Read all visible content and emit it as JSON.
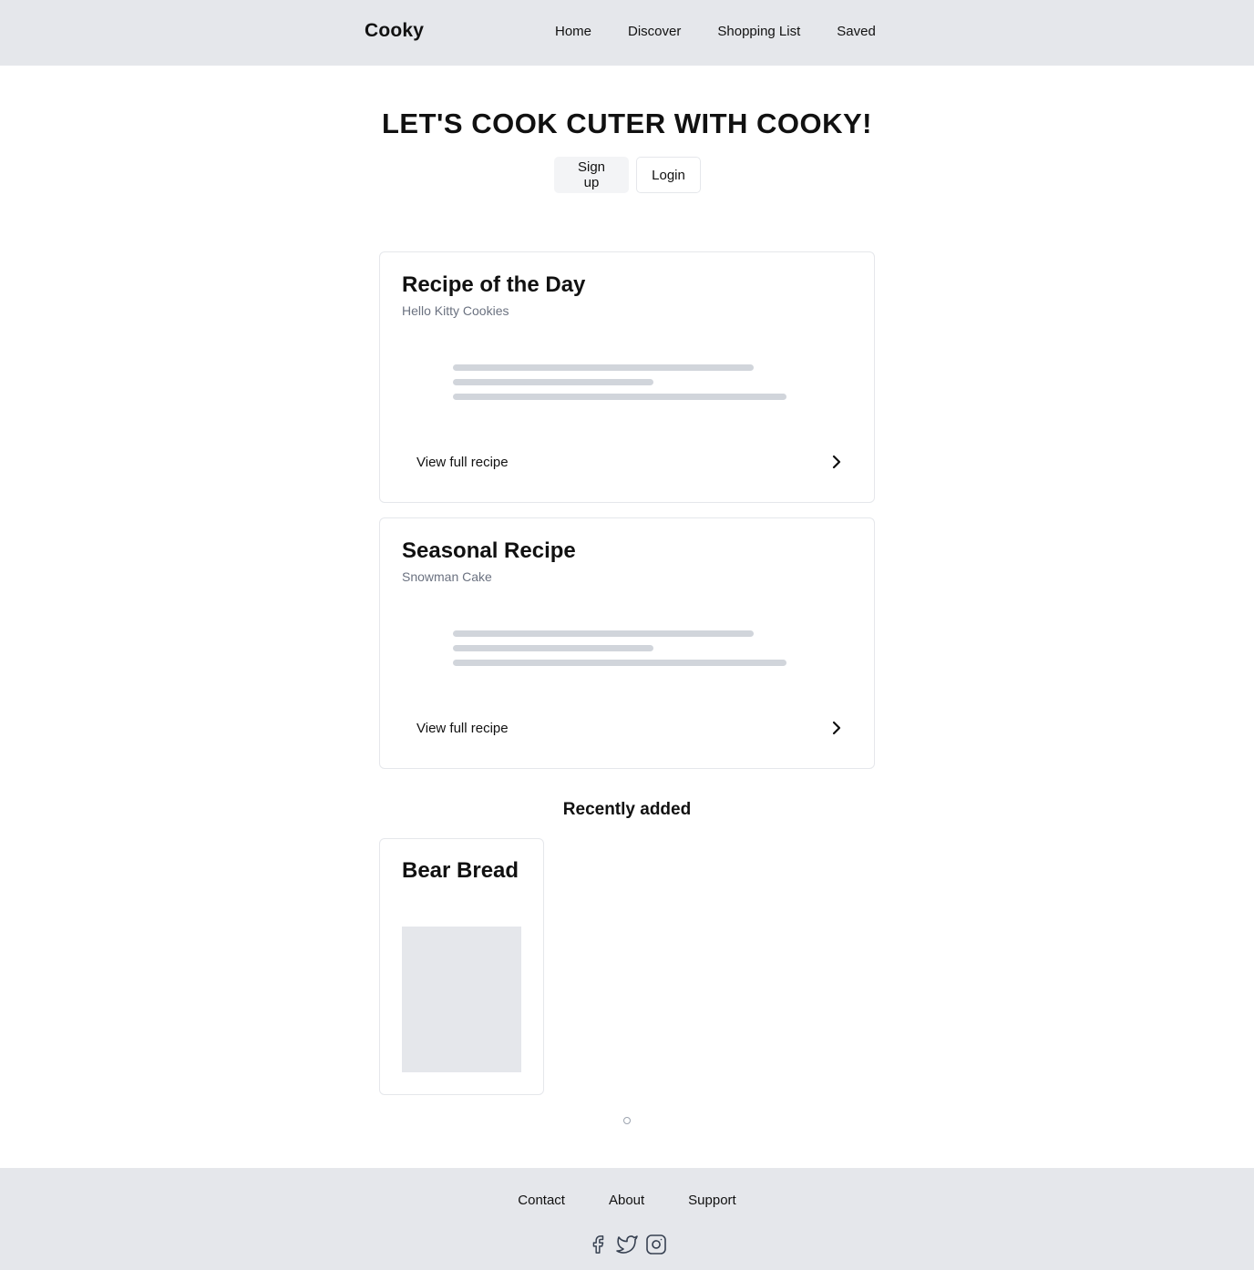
{
  "header": {
    "brand": "Cooky",
    "nav": [
      {
        "label": "Home"
      },
      {
        "label": "Discover"
      },
      {
        "label": "Shopping List"
      },
      {
        "label": "Saved"
      }
    ]
  },
  "hero": {
    "title": "LET'S COOK CUTER WITH COOKY!",
    "signup_label": "Sign up",
    "login_label": "Login"
  },
  "cards": [
    {
      "title": "Recipe of the Day",
      "subtitle": "Hello Kitty Cookies",
      "link_label": "View full recipe",
      "link_icon": "chevron-right-icon"
    },
    {
      "title": "Seasonal Recipe",
      "subtitle": "Snowman Cake",
      "link_label": "View full recipe",
      "link_icon": "chevron-right-icon"
    }
  ],
  "recently_added": {
    "title": "Recently added",
    "items": [
      {
        "title": "Bear Bread"
      }
    ],
    "pagination": {
      "current": 1,
      "total": 1
    }
  },
  "footer": {
    "links": [
      {
        "label": "Contact"
      },
      {
        "label": "About"
      },
      {
        "label": "Support"
      }
    ],
    "socials": [
      "facebook-icon",
      "twitter-icon",
      "instagram-icon"
    ]
  },
  "colors": {
    "bar_background": "#e5e7eb",
    "skeleton": "#d1d5db",
    "muted_text": "#6b7280",
    "primary_text": "#111111"
  }
}
